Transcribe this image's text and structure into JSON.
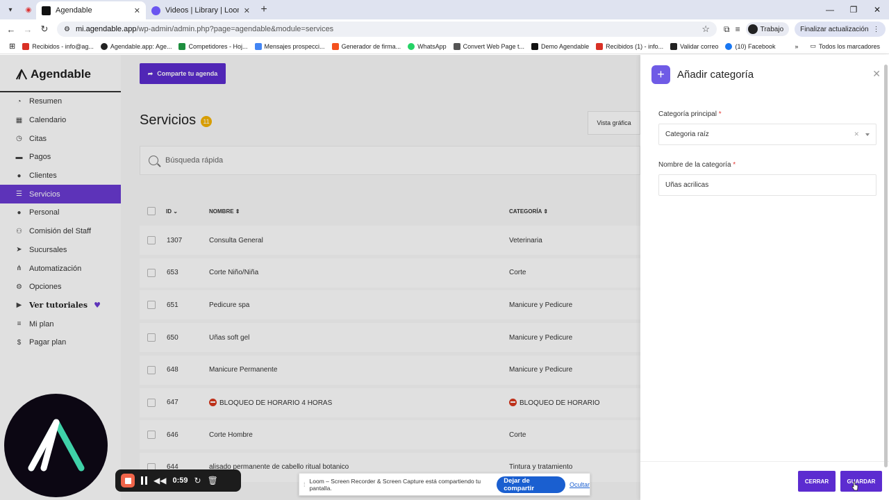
{
  "browser": {
    "tabs": [
      {
        "title": "Agendable",
        "active": true
      },
      {
        "title": "Videos | Library | Loom",
        "active": false
      }
    ],
    "url_host": "mi.agendable.app",
    "url_path": "/wp-admin/admin.php?page=agendable&module=services",
    "profile": "Trabajo",
    "update_label": "Finalizar actualización",
    "bookmarks": [
      "Recibidos - info@ag...",
      "Agendable.app: Age...",
      "Competidores - Hoj...",
      "Mensajes prospecci...",
      "Generador de firma...",
      "WhatsApp",
      "Convert Web Page t...",
      "Demo Agendable",
      "Recibidos (1) - info...",
      "Validar correo",
      "(10) Facebook"
    ],
    "all_bookmarks": "Todos los marcadores"
  },
  "sidebar": {
    "brand": "Agendable",
    "items": [
      {
        "label": "Resumen",
        "icon": "pie-icon"
      },
      {
        "label": "Calendario",
        "icon": "calendar-icon"
      },
      {
        "label": "Citas",
        "icon": "clock-icon"
      },
      {
        "label": "Pagos",
        "icon": "card-icon"
      },
      {
        "label": "Clientes",
        "icon": "users-icon"
      },
      {
        "label": "Servicios",
        "icon": "list-icon",
        "active": true
      },
      {
        "label": "Personal",
        "icon": "person-icon"
      },
      {
        "label": "Comisión del Staff",
        "icon": "percent-icon"
      },
      {
        "label": "Sucursales",
        "icon": "location-icon"
      },
      {
        "label": "Automatización",
        "icon": "flow-icon"
      },
      {
        "label": "Opciones",
        "icon": "gear-icon"
      },
      {
        "label": "Ver tutoriales",
        "icon": "video-icon"
      },
      {
        "label": "Mi plan",
        "icon": "menu-icon"
      },
      {
        "label": "Pagar plan",
        "icon": "dollar-icon"
      }
    ]
  },
  "main": {
    "share_label": "Comparte tu agenda",
    "title": "Servicios",
    "count": "11",
    "view_label": "Vista gráfica",
    "search_placeholder": "Búsqueda rápida",
    "columns": {
      "id": "ID",
      "name": "NOMBRE",
      "category": "CATEGORÍA"
    },
    "rows": [
      {
        "id": "1307",
        "name": "Consulta General",
        "category": "Veterinaria"
      },
      {
        "id": "653",
        "name": "Corte Niño/Niña",
        "category": "Corte"
      },
      {
        "id": "651",
        "name": "Pedicure spa",
        "category": "Manicure y Pedicure"
      },
      {
        "id": "650",
        "name": "Uñas soft gel",
        "category": "Manicure y Pedicure"
      },
      {
        "id": "648",
        "name": "Manicure Permanente",
        "category": "Manicure y Pedicure"
      },
      {
        "id": "647",
        "name": "BLOQUEO DE HORARIO 4 HORAS",
        "category": "BLOQUEO DE HORARIO",
        "blocked": true
      },
      {
        "id": "646",
        "name": "Corte Hombre",
        "category": "Corte"
      },
      {
        "id": "644",
        "name": "alisado permanente de cabello ritual botanico",
        "category": "Tintura y tratamiento"
      }
    ]
  },
  "panel": {
    "title": "Añadir categoría",
    "parent_label": "Categoría principal",
    "parent_value": "Categoria raíz",
    "name_label": "Nombre de la categoría",
    "name_value": "Uñas acrilicas",
    "close_label": "CERRAR",
    "save_label": "GUARDAR"
  },
  "loom": {
    "timer": "0:59",
    "notice": "Loom – Screen Recorder & Screen Capture está compartiendo tu pantalla.",
    "stop_label": "Dejar de compartir",
    "hide_label": "Ocultar"
  },
  "colors": {
    "accent": "#5c2cd0",
    "sidebar_active": "#6a3bd3",
    "badge": "#f5b300",
    "loom_red": "#f1654a",
    "loom_blue": "#1a5fd0"
  }
}
